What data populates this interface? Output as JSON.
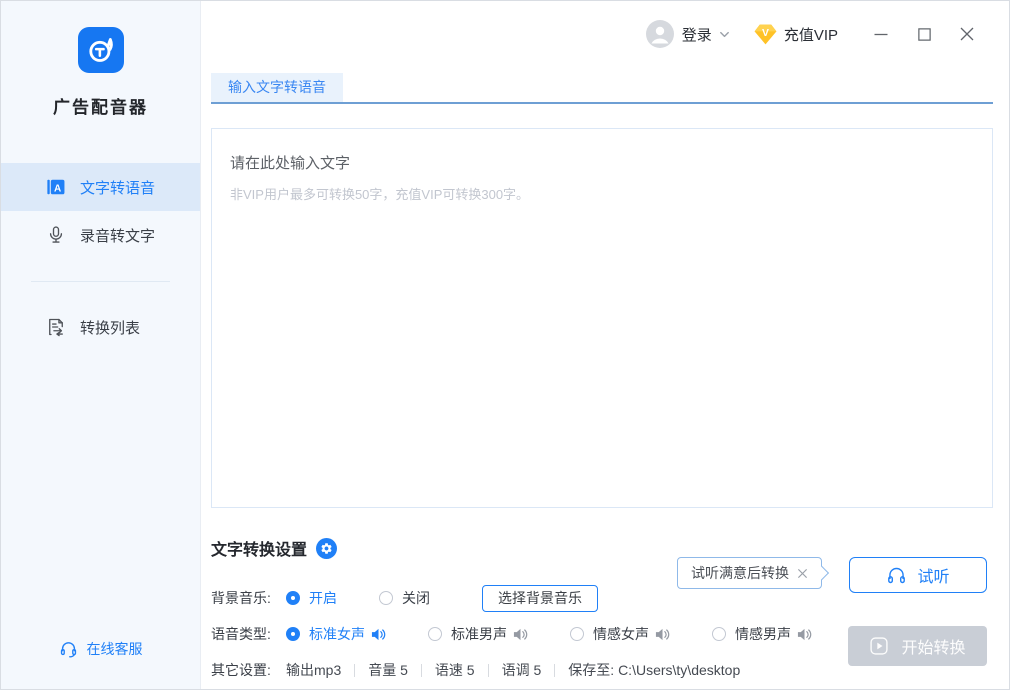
{
  "app": {
    "name": "广告配音器"
  },
  "sidebar": {
    "items": [
      {
        "label": "文字转语音",
        "active": true
      },
      {
        "label": "录音转文字",
        "active": false
      },
      {
        "label": "转换列表",
        "active": false
      }
    ],
    "customer_service": "在线客服"
  },
  "topbar": {
    "login_label": "登录",
    "recharge_label": "充值VIP"
  },
  "main": {
    "tab": "输入文字转语音",
    "editor": {
      "placeholder_title": "请在此处输入文字",
      "placeholder_hint": "非VIP用户最多可转换50字，充值VIP可转换300字。"
    },
    "settings": {
      "title": "文字转换设置",
      "bg_music": {
        "label": "背景音乐:",
        "options": [
          "开启",
          "关闭"
        ],
        "selected": "开启",
        "choose_button": "选择背景音乐"
      },
      "voice_type": {
        "label": "语音类型:",
        "options": [
          "标准女声",
          "标准男声",
          "情感女声",
          "情感男声"
        ],
        "selected": "标准女声"
      },
      "other": {
        "label": "其它设置:",
        "items": [
          "输出mp3",
          "音量 5",
          "语速 5",
          "语调 5",
          "保存至: C:\\Users\\ty\\desktop"
        ]
      }
    },
    "tooltip_text": "试听满意后转换",
    "audition_label": "试听",
    "convert_label": "开始转换"
  },
  "colors": {
    "accent": "#2080f7",
    "vip_gold": "#ffc226",
    "convert_disabled_bg": "#c9ced6",
    "sidebar_bg": "#f4f8fd",
    "active_item_bg": "#dce9f9"
  }
}
